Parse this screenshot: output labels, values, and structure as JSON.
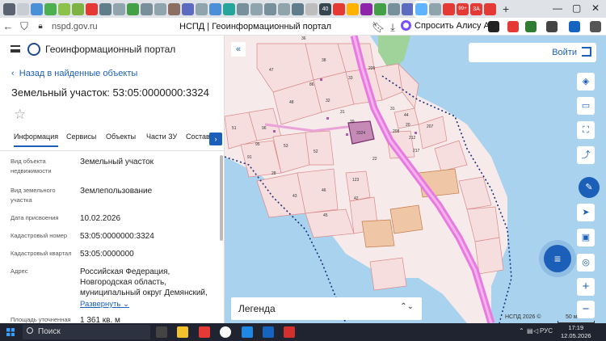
{
  "browser": {
    "url": "nspd.gov.ru",
    "page_title": "НСПД | Геоинформационный портал",
    "alice_label": "Спросить Алису AI",
    "tab_badges": [
      "40",
      "99+",
      "3A"
    ]
  },
  "panel": {
    "portal_name": "Геоинформационный портал",
    "back_link": "Назад в найденные объекты",
    "object_title": "Земельный участок: 53:05:0000000:3324",
    "tabs": [
      "Информация",
      "Сервисы",
      "Объекты",
      "Части ЗУ",
      "Состав"
    ],
    "fields": [
      {
        "label": "Вид объекта недвижимости",
        "value": "Земельный участок"
      },
      {
        "label": "Вид земельного участка",
        "value": "Землепользование"
      },
      {
        "label": "Дата присвоения",
        "value": "10.02.2026"
      },
      {
        "label": "Кадастровый номер",
        "value": "53:05:0000000:3324"
      },
      {
        "label": "Кадастровый квартал",
        "value": "53:05:0000000"
      },
      {
        "label": "Адрес",
        "value": "Российская Федерация, Новгородская область, муниципальный округ Демянский,"
      },
      {
        "label": "Площадь уточненная",
        "value": "1 361 кв. м"
      }
    ],
    "expand_label": "Развернуть"
  },
  "map": {
    "login_label": "Войти",
    "legend_label": "Легенда",
    "copyright": "НСПД 2026 ©",
    "scale_label": "50 м",
    "parcel_labels": [
      "3324",
      "47",
      "36",
      "38",
      "226",
      "86",
      "48",
      "32",
      "31",
      "33",
      "39",
      "31",
      "44",
      "212",
      "207",
      "217",
      "51",
      "96",
      "95",
      "53",
      "52",
      "91",
      "28",
      "43",
      "46",
      "45",
      "123",
      "42",
      "22",
      "208",
      "20"
    ]
  },
  "taskbar": {
    "search_label": "Поиск",
    "lang": "РУС",
    "time": "17:19",
    "date": "12.05.2026"
  },
  "colors": {
    "accent": "#1c5fb8",
    "water": "#a9d2ee",
    "parcel_fill": "#f7dede",
    "parcel_stroke": "#d98a8a",
    "road": "#e77be0",
    "selected": "#b26aa0"
  }
}
